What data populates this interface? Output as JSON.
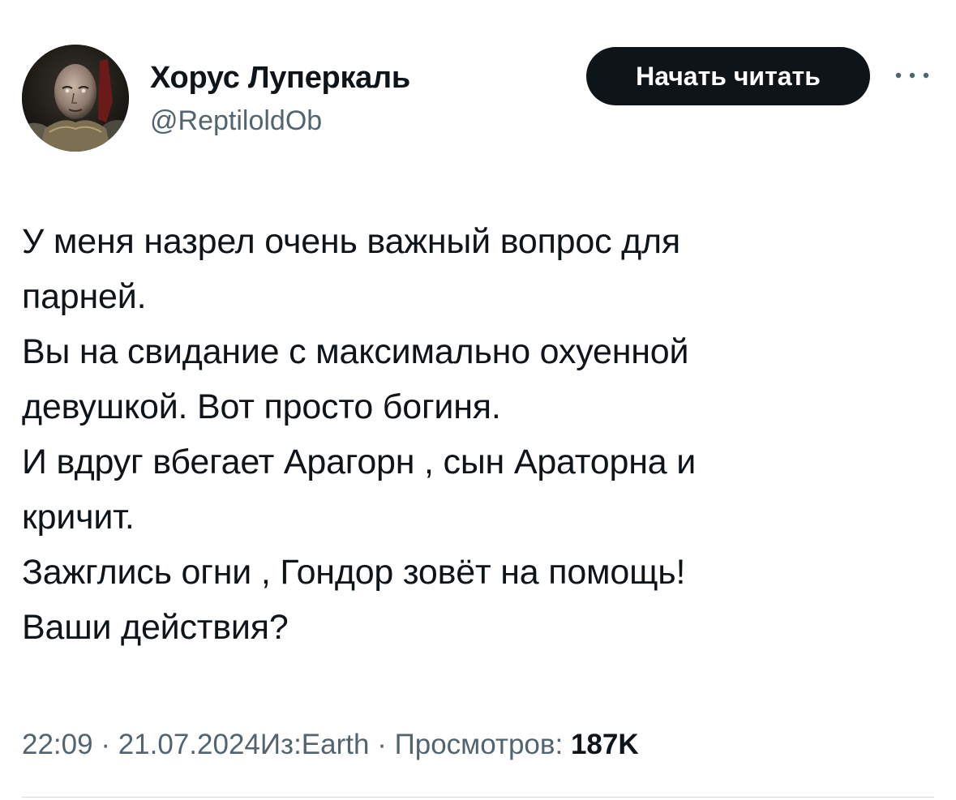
{
  "author": {
    "display_name": "Хорус Луперкаль",
    "handle": "@ReptiloldOb",
    "avatar_icon": "warrior-portrait-avatar"
  },
  "follow_button": {
    "label": "Начать читать"
  },
  "more_menu": {
    "icon": "more-horizontal-icon"
  },
  "tweet": {
    "lines": [
      "У меня назрел очень важный вопрос для",
      "парней.",
      "Вы на свидание с максимально охуенной",
      "девушкой. Вот просто богиня.",
      "И вдруг вбегает Арагорн , сын Араторна и",
      "кричит.",
      "Зажглись огни , Гондор зовёт на помощь!",
      "Ваши действия?"
    ]
  },
  "meta": {
    "time": "22:09",
    "separator": " · ",
    "date": "21.07.2024",
    "source": "Из:Earth",
    "views_label": "Просмотров: ",
    "views_count": "187K"
  },
  "colors": {
    "text": "#0f1419",
    "secondary": "#536471",
    "button_bg": "#0f1419",
    "button_text": "#ffffff"
  }
}
